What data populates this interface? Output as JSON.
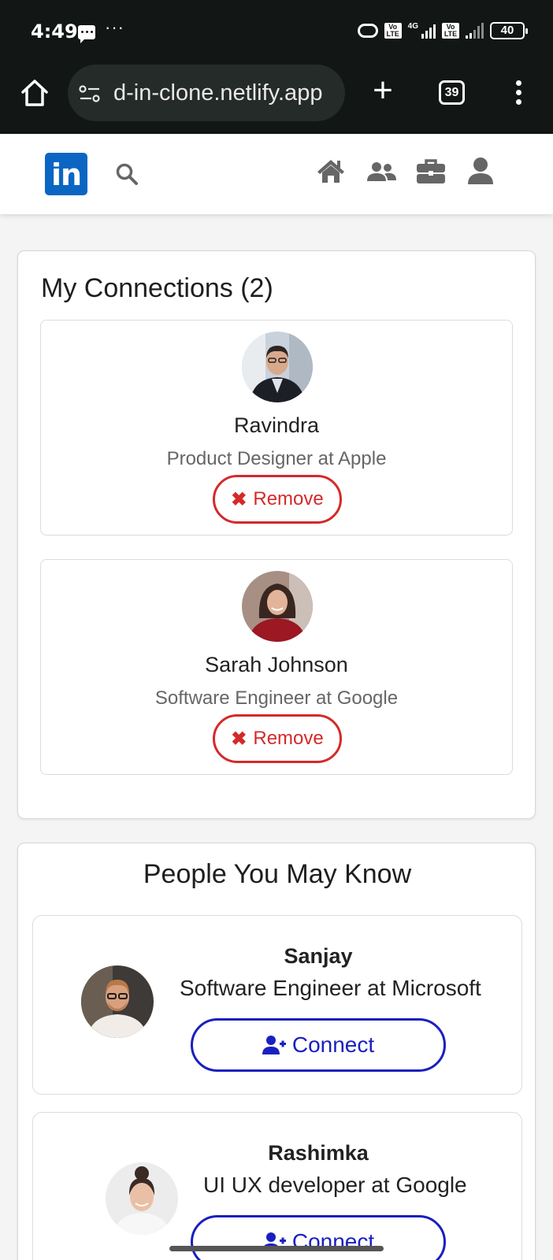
{
  "status_bar": {
    "time": "4:49",
    "dots": "···",
    "network": "4G",
    "volte_tag": "Vo LTE",
    "battery": "40"
  },
  "browser": {
    "url": "d-in-clone.netlify.app",
    "tab_count": "39",
    "new_tab_label": "+"
  },
  "navbar": {
    "logo_text": "in",
    "brand_color": "#0a66c2",
    "icons": [
      "home-icon",
      "users-icon",
      "briefcase-icon",
      "user-icon"
    ]
  },
  "connections": {
    "title": "My Connections (2)",
    "items": [
      {
        "name": "Ravindra",
        "role": "Product Designer at Apple",
        "button": "Remove"
      },
      {
        "name": "Sarah Johnson",
        "role": "Software Engineer at Google",
        "button": "Remove"
      }
    ]
  },
  "suggestions": {
    "title": "People You May Know",
    "items": [
      {
        "name": "Sanjay",
        "role": "Software Engineer at Microsoft",
        "button": "Connect"
      },
      {
        "name": "Rashimka",
        "role": "UI UX developer at Google",
        "button": "Connect"
      }
    ]
  },
  "colors": {
    "remove": "#d42a2a",
    "connect": "#1a1fbf",
    "chrome_bg": "#121614"
  }
}
